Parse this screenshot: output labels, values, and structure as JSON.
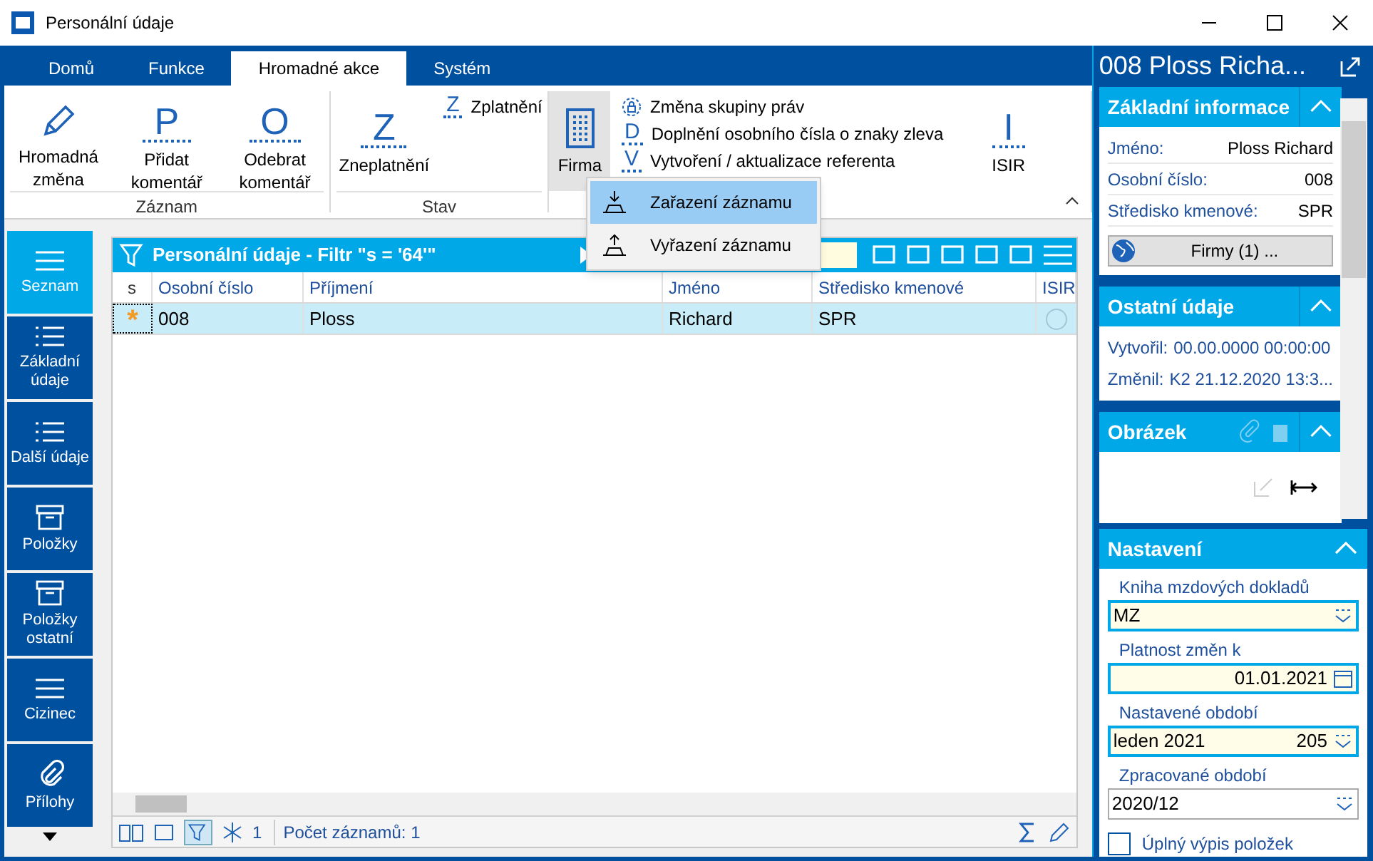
{
  "window": {
    "title": "Personální údaje"
  },
  "ribbon": {
    "tabs": [
      {
        "label": "Domů",
        "selected": false
      },
      {
        "label": "Funkce",
        "selected": false
      },
      {
        "label": "Hromadné akce",
        "selected": true
      },
      {
        "label": "Systém",
        "selected": false
      }
    ],
    "groups": [
      {
        "label": "Záznam",
        "items": [
          {
            "kind": "big",
            "label": "Hromadná změna"
          },
          {
            "kind": "big",
            "glyph": "P",
            "label": "Přidat komentář"
          },
          {
            "kind": "big",
            "glyph": "O",
            "label": "Odebrat komentář"
          }
        ]
      },
      {
        "label": "Stav",
        "items": [
          {
            "kind": "big",
            "glyph": "Z",
            "label": "Zneplatnění"
          },
          {
            "kind": "small",
            "glyph": "Z",
            "label": "Zplatnění"
          }
        ]
      },
      {
        "items": [
          {
            "kind": "big",
            "label": "Firma",
            "selected": true
          },
          {
            "kind": "small",
            "label": "Změna skupiny práv"
          },
          {
            "kind": "small",
            "glyph": "D",
            "label": "Doplnění osobního čísla o znaky zleva"
          },
          {
            "kind": "small",
            "glyph": "V",
            "label": "Vytvoření / aktualizace referenta"
          },
          {
            "kind": "big",
            "glyph": "I",
            "label": "ISIR"
          }
        ]
      }
    ]
  },
  "popup_menu": [
    {
      "label": "Zařazení záznamu",
      "selected": true
    },
    {
      "label": "Vyřazení záznamu",
      "selected": false
    }
  ],
  "sidebar": [
    {
      "label": "Seznam",
      "selected": true,
      "kind": "menu"
    },
    {
      "label": "Základní údaje",
      "selected": false,
      "kind": "list"
    },
    {
      "label": "Další údaje",
      "selected": false,
      "kind": "list"
    },
    {
      "label": "Položky",
      "selected": false,
      "kind": "box"
    },
    {
      "label": "Položky ostatní",
      "selected": false,
      "kind": "box"
    },
    {
      "label": "Cizinec",
      "selected": false,
      "kind": "menu"
    },
    {
      "label": "Přílohy",
      "selected": false,
      "kind": "clip"
    }
  ],
  "grid": {
    "title": "Personální údaje - Filtr \"s = '64'\"",
    "columns": [
      "s",
      "Osobní číslo",
      "Příjmení",
      "Jméno",
      "Středisko kmenové",
      "ISIR"
    ],
    "rows": [
      {
        "selected": true,
        "cells": [
          "*",
          "008",
          "Ploss",
          "Richard",
          "SPR"
        ]
      }
    ],
    "filter_count": "1",
    "record_count": "Počet záznamů: 1"
  },
  "detail": {
    "title": "008 Ploss Richa...",
    "basic": {
      "title": "Základní informace",
      "fields": [
        {
          "label": "Jméno:",
          "value": "Ploss Richard"
        },
        {
          "label": "Osobní číslo:",
          "value": "008"
        },
        {
          "label": "Středisko kmenové:",
          "value": "SPR"
        }
      ],
      "button": "Firmy (1) ..."
    },
    "other": {
      "title": "Ostatní údaje",
      "fields": [
        {
          "label": "Vytvořil:",
          "value": "00.00.0000 00:00:00"
        },
        {
          "label": "Změnil:",
          "value": "K2 21.12.2020 13:3..."
        }
      ]
    },
    "image": {
      "title": "Obrázek"
    },
    "settings": {
      "title": "Nastavení",
      "fields": [
        {
          "label": "Kniha mzdových dokladů",
          "value": "MZ",
          "kind": "combo",
          "highlight": true
        },
        {
          "label": "Platnost změn k",
          "value": "01.01.2021",
          "kind": "date",
          "highlight": true
        },
        {
          "label": "Nastavené období",
          "value": "leden 2021",
          "extra": "205",
          "kind": "combo",
          "highlight": true
        },
        {
          "label": "Zpracované období",
          "value": "2020/12",
          "kind": "combo",
          "highlight": false
        }
      ],
      "checkbox": {
        "label": "Úplný výpis položek",
        "checked": false
      }
    }
  }
}
